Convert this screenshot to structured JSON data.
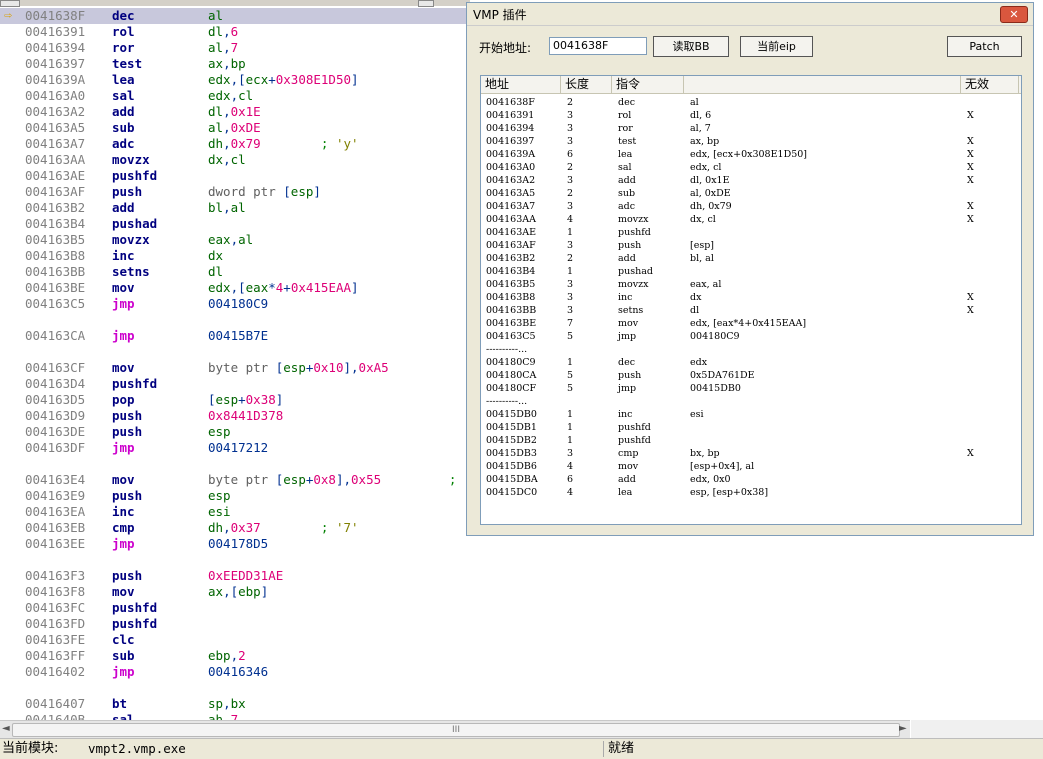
{
  "disasm": {
    "current_arrow": "⇨",
    "rows": [
      {
        "addr": "0041638F",
        "mn": "dec",
        "ops": [
          [
            "reg",
            "al"
          ]
        ],
        "current": true
      },
      {
        "addr": "00416391",
        "mn": "rol",
        "ops": [
          [
            "reg",
            "dl"
          ],
          [
            "txt",
            ","
          ],
          [
            "num",
            "6"
          ]
        ]
      },
      {
        "addr": "00416394",
        "mn": "ror",
        "ops": [
          [
            "reg",
            "al"
          ],
          [
            "txt",
            ","
          ],
          [
            "num",
            "7"
          ]
        ]
      },
      {
        "addr": "00416397",
        "mn": "test",
        "ops": [
          [
            "reg",
            "ax"
          ],
          [
            "txt",
            ","
          ],
          [
            "reg",
            "bp"
          ]
        ]
      },
      {
        "addr": "0041639A",
        "mn": "lea",
        "ops": [
          [
            "reg",
            "edx"
          ],
          [
            "txt",
            ",["
          ],
          [
            "reg",
            "ecx"
          ],
          [
            "txt",
            "+"
          ],
          [
            "num",
            "0x308E1D50"
          ],
          [
            "txt",
            "]"
          ]
        ]
      },
      {
        "addr": "004163A0",
        "mn": "sal",
        "ops": [
          [
            "reg",
            "edx"
          ],
          [
            "txt",
            ","
          ],
          [
            "reg",
            "cl"
          ]
        ]
      },
      {
        "addr": "004163A2",
        "mn": "add",
        "ops": [
          [
            "reg",
            "dl"
          ],
          [
            "txt",
            ","
          ],
          [
            "num",
            "0x1E"
          ]
        ]
      },
      {
        "addr": "004163A5",
        "mn": "sub",
        "ops": [
          [
            "reg",
            "al"
          ],
          [
            "txt",
            ","
          ],
          [
            "num",
            "0xDE"
          ]
        ]
      },
      {
        "addr": "004163A7",
        "mn": "adc",
        "ops": [
          [
            "reg",
            "dh"
          ],
          [
            "txt",
            ","
          ],
          [
            "num",
            "0x79"
          ],
          [
            "cmt",
            "        ; "
          ],
          [
            "str",
            "'y'"
          ]
        ]
      },
      {
        "addr": "004163AA",
        "mn": "movzx",
        "ops": [
          [
            "reg",
            "dx"
          ],
          [
            "txt",
            ","
          ],
          [
            "reg",
            "cl"
          ]
        ]
      },
      {
        "addr": "004163AE",
        "mn": "pushfd",
        "ops": []
      },
      {
        "addr": "004163AF",
        "mn": "push",
        "ops": [
          [
            "kw",
            "dword ptr "
          ],
          [
            "txt",
            "["
          ],
          [
            "reg",
            "esp"
          ],
          [
            "txt",
            "]"
          ]
        ]
      },
      {
        "addr": "004163B2",
        "mn": "add",
        "ops": [
          [
            "reg",
            "bl"
          ],
          [
            "txt",
            ","
          ],
          [
            "reg",
            "al"
          ]
        ]
      },
      {
        "addr": "004163B4",
        "mn": "pushad",
        "ops": []
      },
      {
        "addr": "004163B5",
        "mn": "movzx",
        "ops": [
          [
            "reg",
            "eax"
          ],
          [
            "txt",
            ","
          ],
          [
            "reg",
            "al"
          ]
        ]
      },
      {
        "addr": "004163B8",
        "mn": "inc",
        "ops": [
          [
            "reg",
            "dx"
          ]
        ]
      },
      {
        "addr": "004163BB",
        "mn": "setns",
        "ops": [
          [
            "reg",
            "dl"
          ]
        ]
      },
      {
        "addr": "004163BE",
        "mn": "mov",
        "ops": [
          [
            "reg",
            "edx"
          ],
          [
            "txt",
            ",["
          ],
          [
            "reg",
            "eax"
          ],
          [
            "txt",
            "*"
          ],
          [
            "num",
            "4"
          ],
          [
            "txt",
            "+"
          ],
          [
            "num",
            "0x415EAA"
          ],
          [
            "txt",
            "]"
          ]
        ]
      },
      {
        "addr": "004163C5",
        "mn": "jmp",
        "ops": [
          [
            "txt",
            "004180C9"
          ]
        ]
      },
      {
        "blank": true
      },
      {
        "addr": "004163CA",
        "mn": "jmp",
        "ops": [
          [
            "txt",
            "00415B7E"
          ]
        ]
      },
      {
        "blank": true
      },
      {
        "addr": "004163CF",
        "mn": "mov",
        "ops": [
          [
            "kw",
            "byte ptr "
          ],
          [
            "txt",
            "["
          ],
          [
            "reg",
            "esp"
          ],
          [
            "txt",
            "+"
          ],
          [
            "num",
            "0x10"
          ],
          [
            "txt",
            "],"
          ],
          [
            "num",
            "0xA5"
          ]
        ]
      },
      {
        "addr": "004163D4",
        "mn": "pushfd",
        "ops": []
      },
      {
        "addr": "004163D5",
        "mn": "pop",
        "ops": [
          [
            "txt",
            "["
          ],
          [
            "reg",
            "esp"
          ],
          [
            "txt",
            "+"
          ],
          [
            "num",
            "0x38"
          ],
          [
            "txt",
            "]"
          ]
        ]
      },
      {
        "addr": "004163D9",
        "mn": "push",
        "ops": [
          [
            "num",
            "0x8441D378"
          ]
        ]
      },
      {
        "addr": "004163DE",
        "mn": "push",
        "ops": [
          [
            "reg",
            "esp"
          ]
        ]
      },
      {
        "addr": "004163DF",
        "mn": "jmp",
        "ops": [
          [
            "txt",
            "00417212"
          ]
        ]
      },
      {
        "blank": true
      },
      {
        "addr": "004163E4",
        "mn": "mov",
        "ops": [
          [
            "kw",
            "byte ptr "
          ],
          [
            "txt",
            "["
          ],
          [
            "reg",
            "esp"
          ],
          [
            "txt",
            "+"
          ],
          [
            "num",
            "0x8"
          ],
          [
            "txt",
            "],"
          ],
          [
            "num",
            "0x55"
          ],
          [
            "cmt",
            "         ;"
          ]
        ]
      },
      {
        "addr": "004163E9",
        "mn": "push",
        "ops": [
          [
            "reg",
            "esp"
          ]
        ]
      },
      {
        "addr": "004163EA",
        "mn": "inc",
        "ops": [
          [
            "reg",
            "esi"
          ]
        ]
      },
      {
        "addr": "004163EB",
        "mn": "cmp",
        "ops": [
          [
            "reg",
            "dh"
          ],
          [
            "txt",
            ","
          ],
          [
            "num",
            "0x37"
          ],
          [
            "cmt",
            "        ; "
          ],
          [
            "str",
            "'7'"
          ]
        ]
      },
      {
        "addr": "004163EE",
        "mn": "jmp",
        "ops": [
          [
            "txt",
            "004178D5"
          ]
        ]
      },
      {
        "blank": true
      },
      {
        "addr": "004163F3",
        "mn": "push",
        "ops": [
          [
            "num",
            "0xEEDD31AE"
          ]
        ]
      },
      {
        "addr": "004163F8",
        "mn": "mov",
        "ops": [
          [
            "reg",
            "ax"
          ],
          [
            "txt",
            ",["
          ],
          [
            "reg",
            "ebp"
          ],
          [
            "txt",
            "]"
          ]
        ]
      },
      {
        "addr": "004163FC",
        "mn": "pushfd",
        "ops": []
      },
      {
        "addr": "004163FD",
        "mn": "pushfd",
        "ops": []
      },
      {
        "addr": "004163FE",
        "mn": "clc",
        "ops": []
      },
      {
        "addr": "004163FF",
        "mn": "sub",
        "ops": [
          [
            "reg",
            "ebp"
          ],
          [
            "txt",
            ","
          ],
          [
            "num",
            "2"
          ]
        ]
      },
      {
        "addr": "00416402",
        "mn": "jmp",
        "ops": [
          [
            "txt",
            "00416346"
          ]
        ]
      },
      {
        "blank": true
      },
      {
        "addr": "00416407",
        "mn": "bt",
        "ops": [
          [
            "reg",
            "sp"
          ],
          [
            "txt",
            ","
          ],
          [
            "reg",
            "bx"
          ]
        ]
      },
      {
        "addr": "0041640B",
        "mn": "sal",
        "ops": [
          [
            "reg",
            "ah"
          ],
          [
            "txt",
            ","
          ],
          [
            "num",
            "7"
          ]
        ]
      }
    ]
  },
  "hscroll": {
    "left_arrow": "◄",
    "right_arrow": "►",
    "thumb_grip": "III"
  },
  "status": {
    "label": "当前模块:",
    "module": "vmpt2.vmp.exe",
    "state": "就绪"
  },
  "plugin": {
    "title": "VMP 插件",
    "close": "✕",
    "start_label": "开始地址:",
    "start_value": "0041638F",
    "btn_read": "读取BB",
    "btn_eip": "当前eip",
    "btn_patch": "Patch",
    "columns": [
      "地址",
      "长度",
      "指令",
      "",
      "无效"
    ],
    "rows": [
      {
        "addr": "0041638F",
        "len": "2",
        "mn": "dec",
        "op": "al",
        "inv": ""
      },
      {
        "addr": "00416391",
        "len": "3",
        "mn": "rol",
        "op": "dl, 6",
        "inv": "X"
      },
      {
        "addr": "00416394",
        "len": "3",
        "mn": "ror",
        "op": "al, 7",
        "inv": ""
      },
      {
        "addr": "00416397",
        "len": "3",
        "mn": "test",
        "op": "ax, bp",
        "inv": "X"
      },
      {
        "addr": "0041639A",
        "len": "6",
        "mn": "lea",
        "op": "edx, [ecx+0x308E1D50]",
        "inv": "X"
      },
      {
        "addr": "004163A0",
        "len": "2",
        "mn": "sal",
        "op": "edx, cl",
        "inv": "X"
      },
      {
        "addr": "004163A2",
        "len": "3",
        "mn": "add",
        "op": "dl, 0x1E",
        "inv": "X"
      },
      {
        "addr": "004163A5",
        "len": "2",
        "mn": "sub",
        "op": "al, 0xDE",
        "inv": ""
      },
      {
        "addr": "004163A7",
        "len": "3",
        "mn": "adc",
        "op": "dh, 0x79",
        "inv": "X"
      },
      {
        "addr": "004163AA",
        "len": "4",
        "mn": "movzx",
        "op": "dx, cl",
        "inv": "X"
      },
      {
        "addr": "004163AE",
        "len": "1",
        "mn": "pushfd",
        "op": "",
        "inv": ""
      },
      {
        "addr": "004163AF",
        "len": "3",
        "mn": "push",
        "op": "[esp]",
        "inv": ""
      },
      {
        "addr": "004163B2",
        "len": "2",
        "mn": "add",
        "op": "bl, al",
        "inv": ""
      },
      {
        "addr": "004163B4",
        "len": "1",
        "mn": "pushad",
        "op": "",
        "inv": ""
      },
      {
        "addr": "004163B5",
        "len": "3",
        "mn": "movzx",
        "op": "eax, al",
        "inv": ""
      },
      {
        "addr": "004163B8",
        "len": "3",
        "mn": "inc",
        "op": "dx",
        "inv": "X"
      },
      {
        "addr": "004163BB",
        "len": "3",
        "mn": "setns",
        "op": "dl",
        "inv": "X"
      },
      {
        "addr": "004163BE",
        "len": "7",
        "mn": "mov",
        "op": "edx, [eax*4+0x415EAA]",
        "inv": ""
      },
      {
        "addr": "004163C5",
        "len": "5",
        "mn": "jmp",
        "op": "004180C9",
        "inv": ""
      },
      {
        "sep": "----------..."
      },
      {
        "addr": "004180C9",
        "len": "1",
        "mn": "dec",
        "op": "edx",
        "inv": ""
      },
      {
        "addr": "004180CA",
        "len": "5",
        "mn": "push",
        "op": "0x5DA761DE",
        "inv": ""
      },
      {
        "addr": "004180CF",
        "len": "5",
        "mn": "jmp",
        "op": "00415DB0",
        "inv": ""
      },
      {
        "sep": "----------..."
      },
      {
        "addr": "00415DB0",
        "len": "1",
        "mn": "inc",
        "op": "esi",
        "inv": ""
      },
      {
        "addr": "00415DB1",
        "len": "1",
        "mn": "pushfd",
        "op": "",
        "inv": ""
      },
      {
        "addr": "00415DB2",
        "len": "1",
        "mn": "pushfd",
        "op": "",
        "inv": ""
      },
      {
        "addr": "00415DB3",
        "len": "3",
        "mn": "cmp",
        "op": "bx, bp",
        "inv": "X"
      },
      {
        "addr": "00415DB6",
        "len": "4",
        "mn": "mov",
        "op": "[esp+0x4], al",
        "inv": ""
      },
      {
        "addr": "00415DBA",
        "len": "6",
        "mn": "add",
        "op": "edx, 0x0",
        "inv": ""
      },
      {
        "addr": "00415DC0",
        "len": "4",
        "mn": "lea",
        "op": "esp, [esp+0x38]",
        "inv": ""
      }
    ]
  }
}
